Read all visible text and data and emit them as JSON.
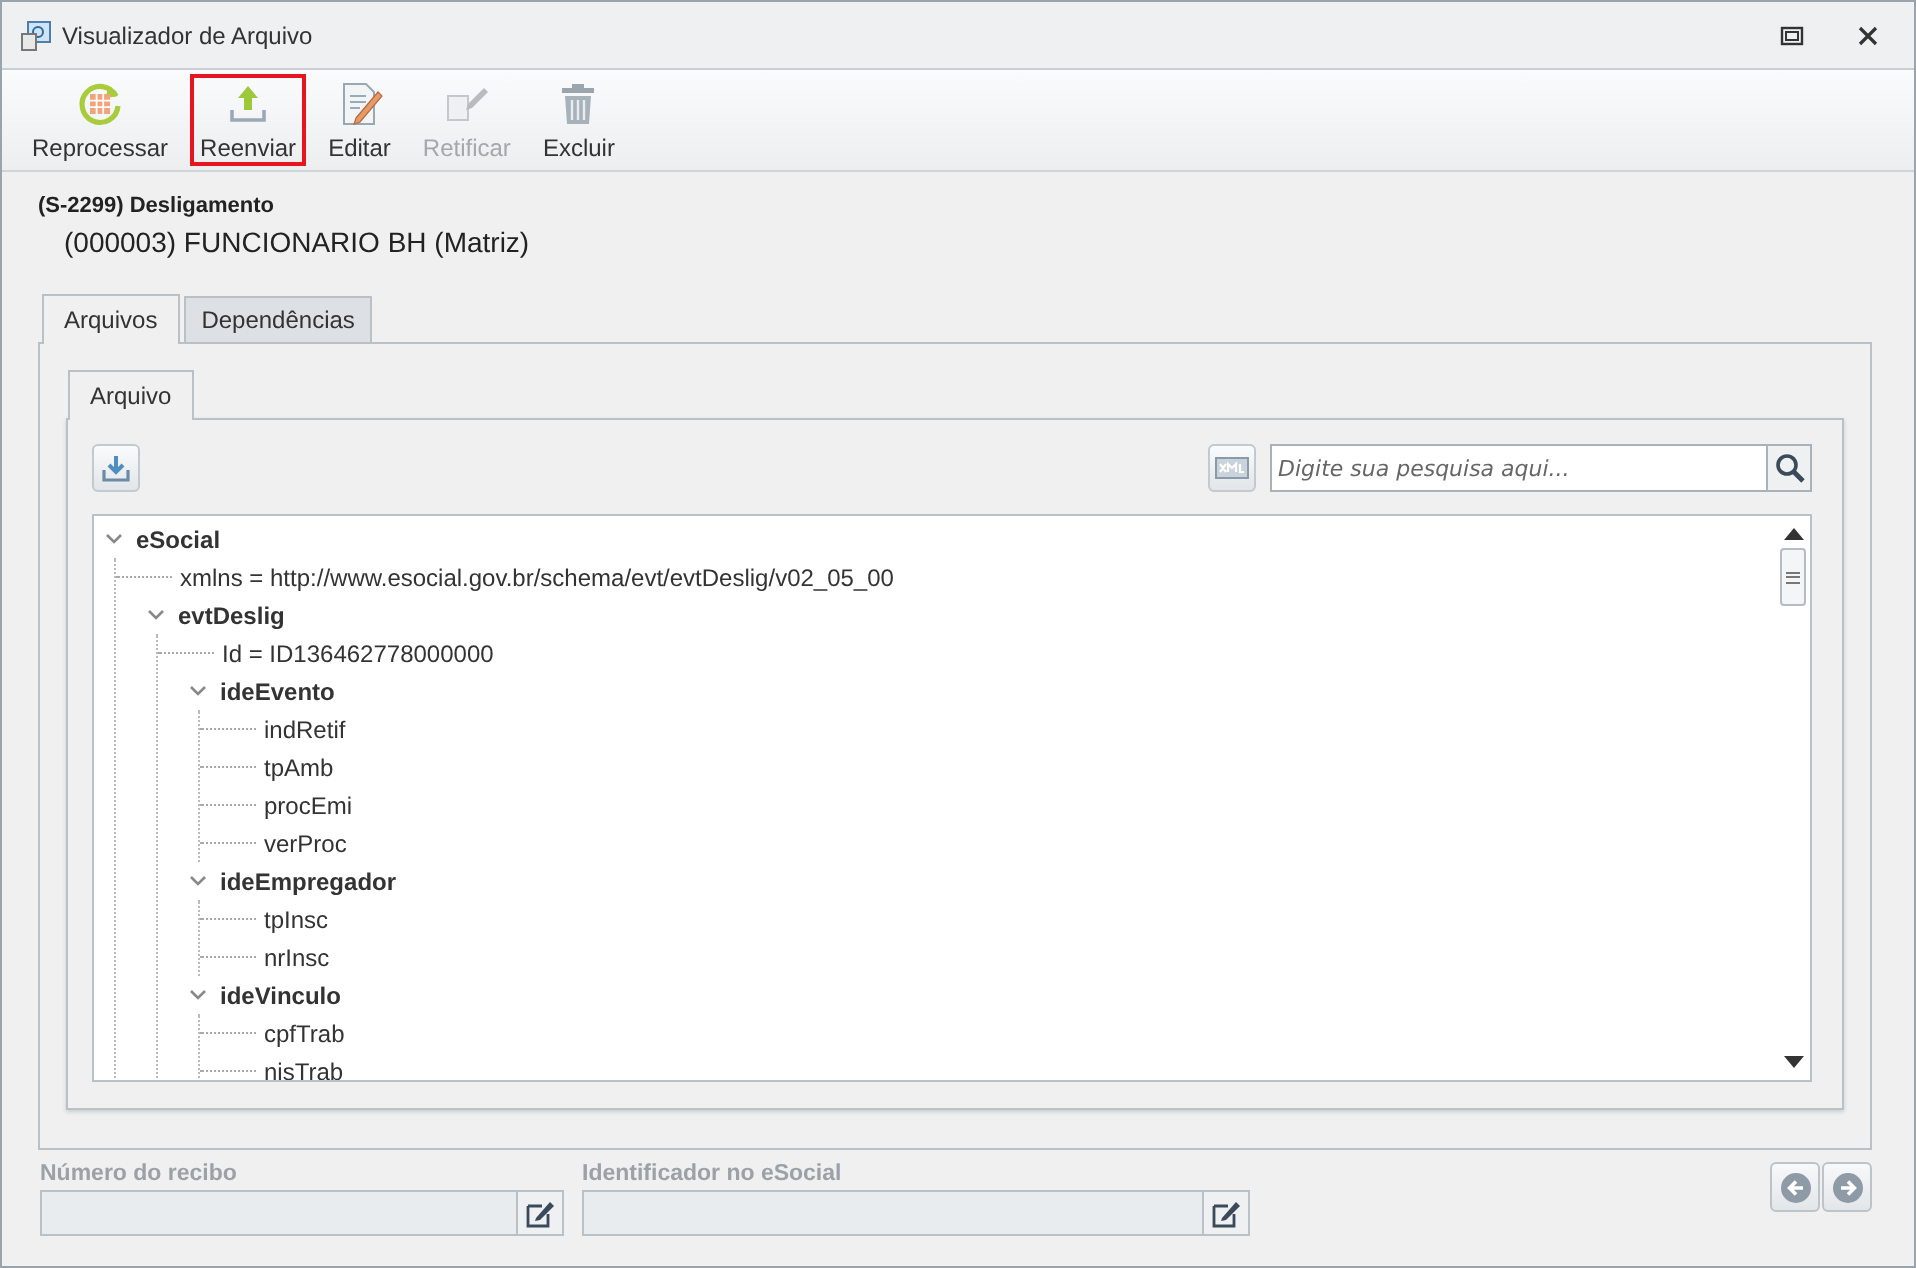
{
  "window": {
    "title": "Visualizador de Arquivo"
  },
  "toolbar": [
    {
      "kind": "reprocess",
      "label": "Reprocessar",
      "disabled": false,
      "highlighted": false
    },
    {
      "kind": "upload",
      "label": "Reenviar",
      "disabled": false,
      "highlighted": true
    },
    {
      "kind": "edit",
      "label": "Editar",
      "disabled": false,
      "highlighted": false
    },
    {
      "kind": "rectify",
      "label": "Retificar",
      "disabled": true,
      "highlighted": false
    },
    {
      "kind": "delete",
      "label": "Excluir",
      "disabled": false,
      "highlighted": false
    }
  ],
  "header": {
    "event": "(S-2299) Desligamento",
    "employee": "(000003) FUNCIONARIO BH (Matriz)"
  },
  "tabs": [
    {
      "label": "Arquivos",
      "selected": true
    },
    {
      "label": "Dependências",
      "selected": false
    }
  ],
  "inner_tabs": [
    {
      "label": "Arquivo",
      "selected": true
    }
  ],
  "search": {
    "placeholder": "Digite sua pesquisa aqui..."
  },
  "tree": [
    {
      "label": "eSocial",
      "expanded": true,
      "children": [
        {
          "label": "xmlns = http://www.esocial.gov.br/schema/evt/evtDeslig/v02_05_00"
        },
        {
          "label": "evtDeslig",
          "expanded": true,
          "children": [
            {
              "label": "Id = ID136462778000000"
            },
            {
              "label": "ideEvento",
              "expanded": true,
              "children": [
                {
                  "label": "indRetif"
                },
                {
                  "label": "tpAmb"
                },
                {
                  "label": "procEmi"
                },
                {
                  "label": "verProc"
                }
              ]
            },
            {
              "label": "ideEmpregador",
              "expanded": true,
              "children": [
                {
                  "label": "tpInsc"
                },
                {
                  "label": "nrInsc"
                }
              ]
            },
            {
              "label": "ideVinculo",
              "expanded": true,
              "children": [
                {
                  "label": "cpfTrab"
                },
                {
                  "label": "nisTrab"
                }
              ]
            }
          ]
        }
      ]
    }
  ],
  "fields": [
    {
      "label": "Número do recibo",
      "disabled": true
    },
    {
      "label": "Identificador no eSocial",
      "disabled": true
    }
  ]
}
